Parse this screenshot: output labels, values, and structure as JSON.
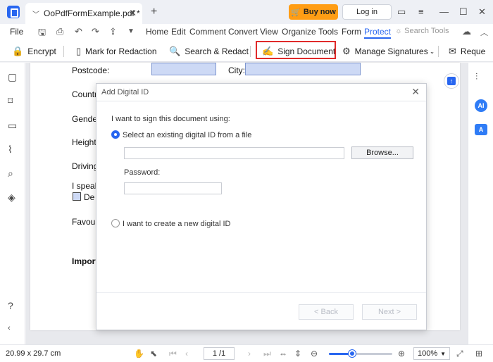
{
  "titlebar": {
    "tab_title": "OoPdfFormExample.pdf *",
    "buy_label": "Buy now",
    "login_label": "Log in"
  },
  "menubar": {
    "file": "File",
    "items": [
      "Home",
      "Edit",
      "Comment",
      "Convert",
      "View",
      "Organize",
      "Tools",
      "Form",
      "Protect"
    ],
    "active": "Protect",
    "search_placeholder": "Search Tools"
  },
  "ribbon": {
    "encrypt": "Encrypt",
    "mark_redaction": "Mark for Redaction",
    "search_redact": "Search & Redact",
    "sign_document": "Sign Document",
    "manage_signatures": "Manage Signatures",
    "request": "Reque"
  },
  "pdf": {
    "postcode": "Postcode:",
    "city": "City:",
    "country": "Countr",
    "gender": "Gende",
    "height": "Height",
    "driving": "Driving",
    "speak": "I speak",
    "lang_de": "De",
    "favourite": "Favour",
    "important": "Import"
  },
  "dialog": {
    "title": "Add Digital ID",
    "prompt": "I want to sign this document using:",
    "option_existing": "Select an existing digital ID from a file",
    "file_path": "",
    "browse": "Browse...",
    "password_label": "Password:",
    "password_value": "",
    "option_new": "I want to create a new digital ID",
    "back": "< Back",
    "next": "Next >"
  },
  "statusbar": {
    "page_size": "20.99 x 29.7 cm",
    "page_indicator": "1 /1",
    "zoom": "100%",
    "zoom_level": 0.37
  },
  "colors": {
    "accent": "#2866f0",
    "buy": "#ff9d14",
    "highlight": "#e02a2a",
    "form_field": "#cdd9f5"
  }
}
